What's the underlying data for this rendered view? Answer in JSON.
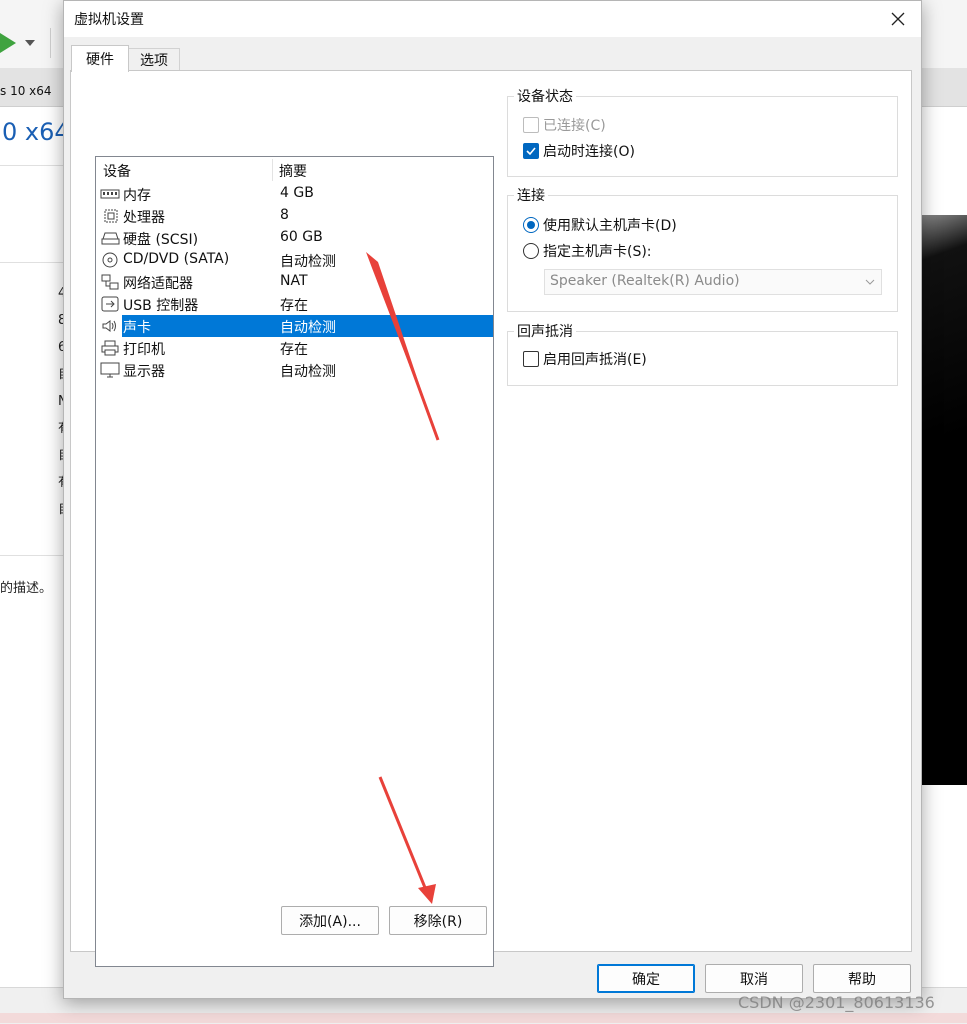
{
  "background_app": {
    "tab_text": "s 10 x64",
    "title": "0 x64",
    "column_letters": [
      "4",
      "8",
      "6",
      "自",
      "N",
      "有",
      "自",
      "有",
      "自"
    ],
    "description": "的描述。"
  },
  "dialog": {
    "title": "虚拟机设置",
    "tabs": [
      {
        "label": "硬件",
        "active": true
      },
      {
        "label": "选项",
        "active": false
      }
    ],
    "device_list": {
      "header": {
        "device": "设备",
        "summary": "摘要"
      },
      "rows": [
        {
          "icon": "memory-icon",
          "name": "内存",
          "summary": "4 GB",
          "selected": false
        },
        {
          "icon": "processor-icon",
          "name": "处理器",
          "summary": "8",
          "selected": false
        },
        {
          "icon": "harddisk-icon",
          "name": "硬盘 (SCSI)",
          "summary": "60 GB",
          "selected": false
        },
        {
          "icon": "cd-dvd-icon",
          "name": "CD/DVD (SATA)",
          "summary": "自动检测",
          "selected": false
        },
        {
          "icon": "network-adapter-icon",
          "name": "网络适配器",
          "summary": "NAT",
          "selected": false
        },
        {
          "icon": "usb-icon",
          "name": "USB 控制器",
          "summary": "存在",
          "selected": false
        },
        {
          "icon": "sound-card-icon",
          "name": "声卡",
          "summary": "自动检测",
          "selected": true
        },
        {
          "icon": "printer-icon",
          "name": "打印机",
          "summary": "存在",
          "selected": false
        },
        {
          "icon": "display-icon",
          "name": "显示器",
          "summary": "自动检测",
          "selected": false
        }
      ]
    },
    "add_button": "添加(A)...",
    "remove_button": "移除(R)",
    "device_status": {
      "title": "设备状态",
      "connected": {
        "label": "已连接(C)",
        "checked": false,
        "enabled": false
      },
      "connect_at_power_on": {
        "label": "启动时连接(O)",
        "checked": true,
        "enabled": true
      }
    },
    "connection": {
      "title": "连接",
      "default_host_sound": {
        "label": "使用默认主机声卡(D)",
        "checked": true
      },
      "specify_host_sound": {
        "label": "指定主机声卡(S):",
        "checked": false
      },
      "sound_select_value": "Speaker (Realtek(R) Audio)"
    },
    "echo_cancel": {
      "title": "回声抵消",
      "enable": {
        "label": "启用回声抵消(E)",
        "checked": false
      }
    },
    "footer": {
      "ok": "确定",
      "cancel": "取消",
      "help": "帮助"
    }
  },
  "watermark": "CSDN @2301_80613136",
  "colors": {
    "selection": "#0078d7",
    "checkbox_accent": "#0067c0",
    "annotation_arrow": "#e8413a"
  }
}
